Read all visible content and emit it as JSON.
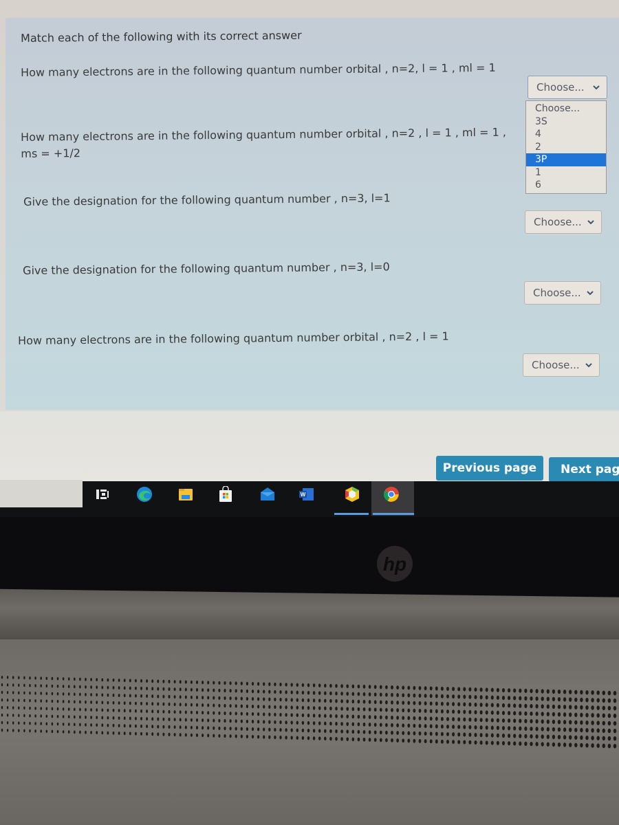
{
  "quiz": {
    "instruction": "Match each of the following with its correct answer",
    "questions": [
      {
        "text": "How many electrons are in the following quantum number orbital , n=2, l = 1 , ml = 1",
        "selected": "Choose..."
      },
      {
        "text": "How many electrons are in the following quantum number orbital , n=2 , l = 1 , ml = 1 , ms = +1/2",
        "selected": "Choose..."
      },
      {
        "text": "Give the designation for  the following quantum number , n=3, l=1",
        "selected": "Choose..."
      },
      {
        "text": "Give the designation for  the following quantum number , n=3, l=0",
        "selected": "Choose..."
      },
      {
        "text": "How many electrons are in the following quantum number orbital , n=2 , l = 1",
        "selected": "Choose..."
      }
    ],
    "open_dropdown": {
      "options": [
        "Choose...",
        "3S",
        "4",
        "2",
        "3P",
        "1",
        "6"
      ],
      "highlighted": "3P"
    }
  },
  "navigation": {
    "previous_label": "Previous page",
    "next_label": "Next page"
  },
  "taskbar": {
    "icons": [
      "task-view",
      "edge",
      "file-explorer",
      "microsoft-store",
      "mail",
      "word",
      "app-hexagon",
      "chrome"
    ],
    "word_letter": "W"
  },
  "device": {
    "logo_text": "hp"
  },
  "colors": {
    "button": "#2b8ab3",
    "highlight": "#1f74d8",
    "panel": "#c5d3da"
  }
}
